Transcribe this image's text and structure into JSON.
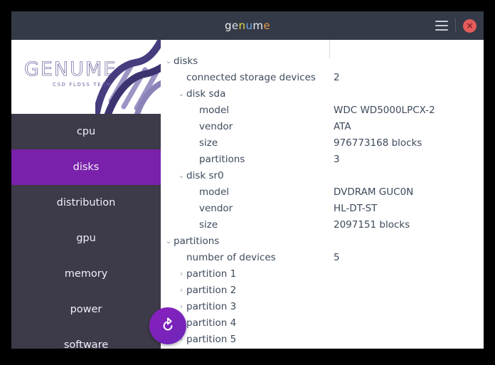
{
  "window": {
    "title_text": "genume",
    "title_letters": [
      {
        "char": "g",
        "color": "#f2f2f2"
      },
      {
        "char": "e",
        "color": "#d8dde6"
      },
      {
        "char": "n",
        "color": "#e8d94a"
      },
      {
        "char": "u",
        "color": "#6ba8e8"
      },
      {
        "char": "m",
        "color": "#f2f2f2"
      },
      {
        "char": "e",
        "color": "#e89a4a"
      }
    ],
    "titlebar_bg": "#343a48",
    "menu_icon": "hamburger-menu-icon",
    "close_icon": "close-icon",
    "close_label": "×"
  },
  "brand": {
    "logo_word": "GENUME",
    "logo_subtitle": "CSD FLOSS TEAM",
    "logo_color": "#4b3c84",
    "dna_icon": "dna-helix-icon"
  },
  "sidebar": {
    "selected": "disks",
    "accent": "#7a21ab",
    "bg": "#3d3a4a",
    "items": [
      {
        "label": "cpu",
        "selected": false
      },
      {
        "label": "disks",
        "selected": true
      },
      {
        "label": "distribution",
        "selected": false
      },
      {
        "label": "gpu",
        "selected": false
      },
      {
        "label": "memory",
        "selected": false
      },
      {
        "label": "power",
        "selected": false
      },
      {
        "label": "software",
        "selected": false
      }
    ]
  },
  "fab": {
    "icon": "refresh-icon",
    "color": "#7a21ab"
  },
  "tree": {
    "rows": [
      {
        "indent": 0,
        "twisty": "⌄",
        "expanded": true,
        "key": "disks",
        "value": ""
      },
      {
        "indent": 1,
        "twisty": "",
        "expanded": null,
        "key": "connected storage devices",
        "value": "2"
      },
      {
        "indent": 1,
        "twisty": "⌄",
        "expanded": true,
        "key": "disk sda",
        "value": ""
      },
      {
        "indent": 2,
        "twisty": "",
        "expanded": null,
        "key": "model",
        "value": "WDC WD5000LPCX-2"
      },
      {
        "indent": 2,
        "twisty": "",
        "expanded": null,
        "key": "vendor",
        "value": "ATA"
      },
      {
        "indent": 2,
        "twisty": "",
        "expanded": null,
        "key": "size",
        "value": "976773168 blocks"
      },
      {
        "indent": 2,
        "twisty": "",
        "expanded": null,
        "key": "partitions",
        "value": "3"
      },
      {
        "indent": 1,
        "twisty": "⌄",
        "expanded": true,
        "key": "disk sr0",
        "value": ""
      },
      {
        "indent": 2,
        "twisty": "",
        "expanded": null,
        "key": "model",
        "value": "DVDRAM GUC0N"
      },
      {
        "indent": 2,
        "twisty": "",
        "expanded": null,
        "key": "vendor",
        "value": "HL-DT-ST"
      },
      {
        "indent": 2,
        "twisty": "",
        "expanded": null,
        "key": "size",
        "value": "2097151 blocks"
      },
      {
        "indent": 0,
        "twisty": "⌄",
        "expanded": true,
        "key": "partitions",
        "value": ""
      },
      {
        "indent": 1,
        "twisty": "",
        "expanded": null,
        "key": "number of devices",
        "value": "5"
      },
      {
        "indent": 1,
        "twisty": "›",
        "expanded": false,
        "key": "partition 1",
        "value": ""
      },
      {
        "indent": 1,
        "twisty": "›",
        "expanded": false,
        "key": "partition 2",
        "value": ""
      },
      {
        "indent": 1,
        "twisty": "›",
        "expanded": false,
        "key": "partition 3",
        "value": ""
      },
      {
        "indent": 1,
        "twisty": "›",
        "expanded": false,
        "key": "partition 4",
        "value": ""
      },
      {
        "indent": 1,
        "twisty": "›",
        "expanded": false,
        "key": "partition 5",
        "value": ""
      }
    ]
  }
}
